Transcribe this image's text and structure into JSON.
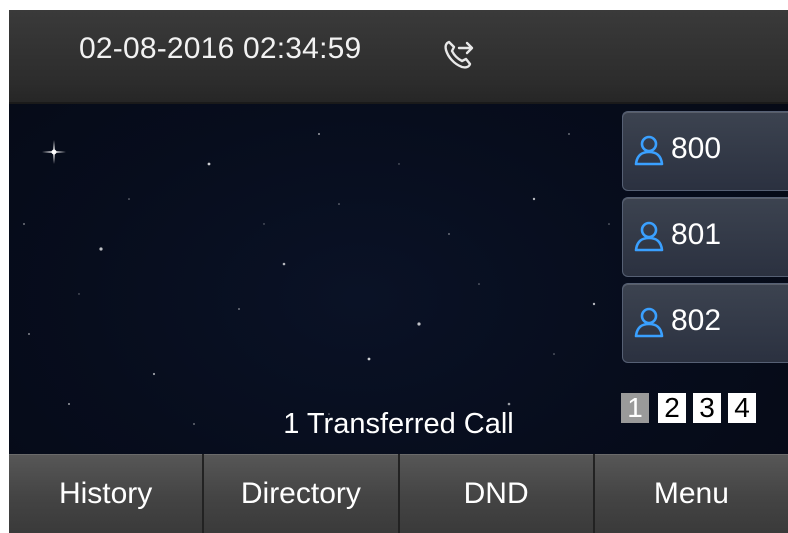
{
  "status": {
    "datetime": "02-08-2016 02:34:59",
    "transfer_icon": "call-transfer-icon"
  },
  "line_keys": [
    {
      "label": "800",
      "icon": "person-icon",
      "icon_color": "#3aa0ff"
    },
    {
      "label": "801",
      "icon": "person-icon",
      "icon_color": "#3aa0ff"
    },
    {
      "label": "802",
      "icon": "person-icon",
      "icon_color": "#3aa0ff"
    }
  ],
  "pages": {
    "items": [
      "1",
      "2",
      "3",
      "4"
    ],
    "active": "1"
  },
  "message": "1 Transferred Call",
  "softkeys": [
    "History",
    "Directory",
    "DND",
    "Menu"
  ]
}
